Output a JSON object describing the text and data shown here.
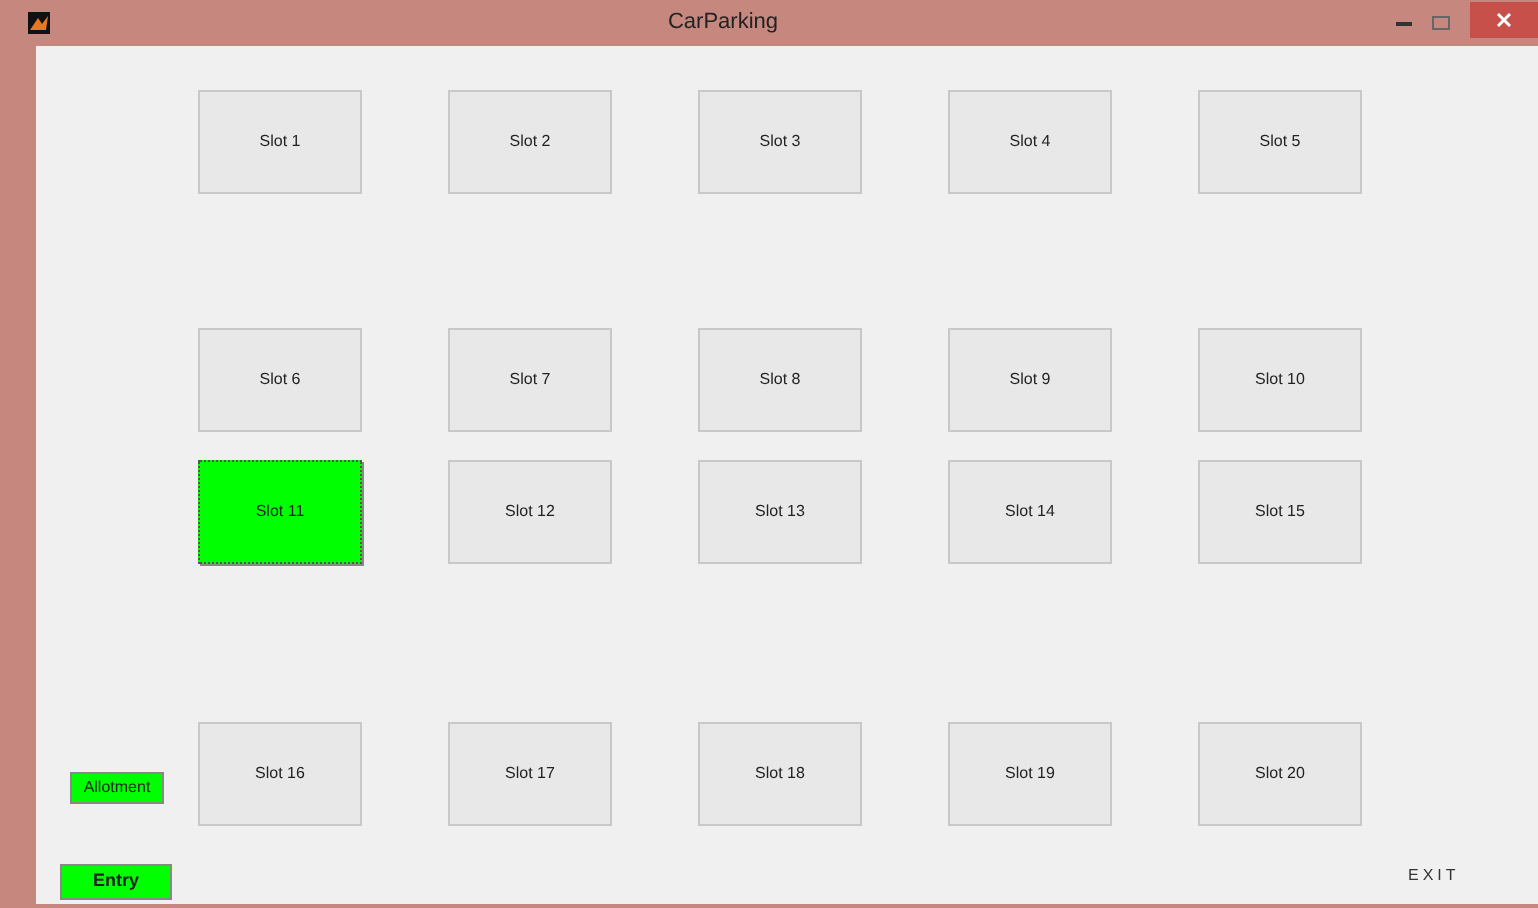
{
  "window": {
    "title": "CarParking"
  },
  "slots": [
    {
      "label": "Slot 1",
      "selected": false
    },
    {
      "label": "Slot 2",
      "selected": false
    },
    {
      "label": "Slot 3",
      "selected": false
    },
    {
      "label": "Slot 4",
      "selected": false
    },
    {
      "label": "Slot 5",
      "selected": false
    },
    {
      "label": "Slot 6",
      "selected": false
    },
    {
      "label": "Slot 7",
      "selected": false
    },
    {
      "label": "Slot 8",
      "selected": false
    },
    {
      "label": "Slot 9",
      "selected": false
    },
    {
      "label": "Slot 10",
      "selected": false
    },
    {
      "label": "Slot 11",
      "selected": true
    },
    {
      "label": "Slot 12",
      "selected": false
    },
    {
      "label": "Slot 13",
      "selected": false
    },
    {
      "label": "Slot 14",
      "selected": false
    },
    {
      "label": "Slot 15",
      "selected": false
    },
    {
      "label": "Slot 16",
      "selected": false
    },
    {
      "label": "Slot 17",
      "selected": false
    },
    {
      "label": "Slot 18",
      "selected": false
    },
    {
      "label": "Slot 19",
      "selected": false
    },
    {
      "label": "Slot 20",
      "selected": false
    }
  ],
  "allotment_button": "Allotment",
  "entry_button": "Entry",
  "exit_label": "EXIT"
}
